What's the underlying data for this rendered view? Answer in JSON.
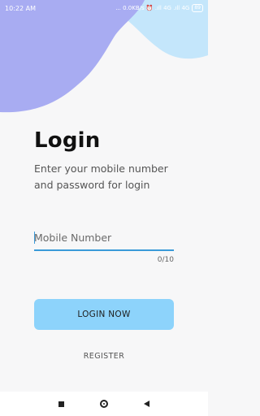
{
  "status_bar": {
    "time": "10:22 AM",
    "indicators": "... 0.0KB/s ⏰ .ıll 4G .ıll 4G",
    "battery": "89"
  },
  "login": {
    "title": "Login",
    "subtitle": "Enter your mobile number and password for login"
  },
  "mobile_field": {
    "placeholder": "Mobile Number",
    "value": "",
    "counter": "0/10"
  },
  "buttons": {
    "login_label": "LOGIN NOW",
    "register_label": "REGISTER"
  },
  "colors": {
    "accent": "#3a9ad9",
    "button_bg": "#8dd3fb",
    "blob_purple": "#a3a7f0",
    "blob_blue": "#bfe3fb"
  },
  "nav_icons": [
    "recents-icon",
    "home-icon",
    "back-icon"
  ]
}
